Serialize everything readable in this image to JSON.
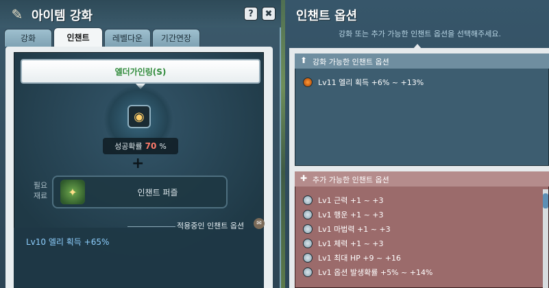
{
  "left_window": {
    "title": "아이템 강화",
    "help_label": "?",
    "close_label": "✖",
    "tabs": [
      {
        "label": "강화"
      },
      {
        "label": "인챈트"
      },
      {
        "label": "레벨다운"
      },
      {
        "label": "기간연장"
      }
    ],
    "item_name": "엘더가인링(S)",
    "success": {
      "label": "성공확률",
      "value": "70",
      "unit": "%"
    },
    "material": {
      "label": "필요\n재료",
      "name": "인챈트 퍼즐"
    },
    "applied": {
      "title": "적용중인 인챈트 옵션",
      "option": "Lv10 엘리 획득 +65%"
    }
  },
  "right_window": {
    "title": "인챈트 옵션",
    "subtitle": "강화 또는 추가 가능한 인챈트 옵션을 선택해주세요.",
    "enhance_section": {
      "title": "강화 가능한 인챈트 옵션",
      "options": [
        {
          "label": "Lv11 엘리 획득 +6% ~ +13%",
          "selected": true
        }
      ]
    },
    "add_section": {
      "title": "추가 가능한 인챈트 옵션",
      "options": [
        {
          "label": "Lv1 근력 +1 ~ +3",
          "selected": false
        },
        {
          "label": "Lv1 행운 +1 ~ +3",
          "selected": false
        },
        {
          "label": "Lv1 마법력 +1 ~ +3",
          "selected": false
        },
        {
          "label": "Lv1 체력 +1 ~ +3",
          "selected": false
        },
        {
          "label": "Lv1 최대 HP +9 ~ +16",
          "selected": false
        },
        {
          "label": "Lv1 옵션 발생확률 +5% ~ +14%",
          "selected": false
        }
      ]
    }
  },
  "icons": {
    "title_icon": "feather-icon",
    "item_icon": "ring-icon",
    "material_icon": "puzzle-icon"
  },
  "colors": {
    "item_name": "#2f8a3a",
    "success_value": "#ff7b6b",
    "applied_option": "#8fd0ff",
    "enhance_bg": "#3d5d70",
    "add_bg": "#9b6b6b"
  }
}
